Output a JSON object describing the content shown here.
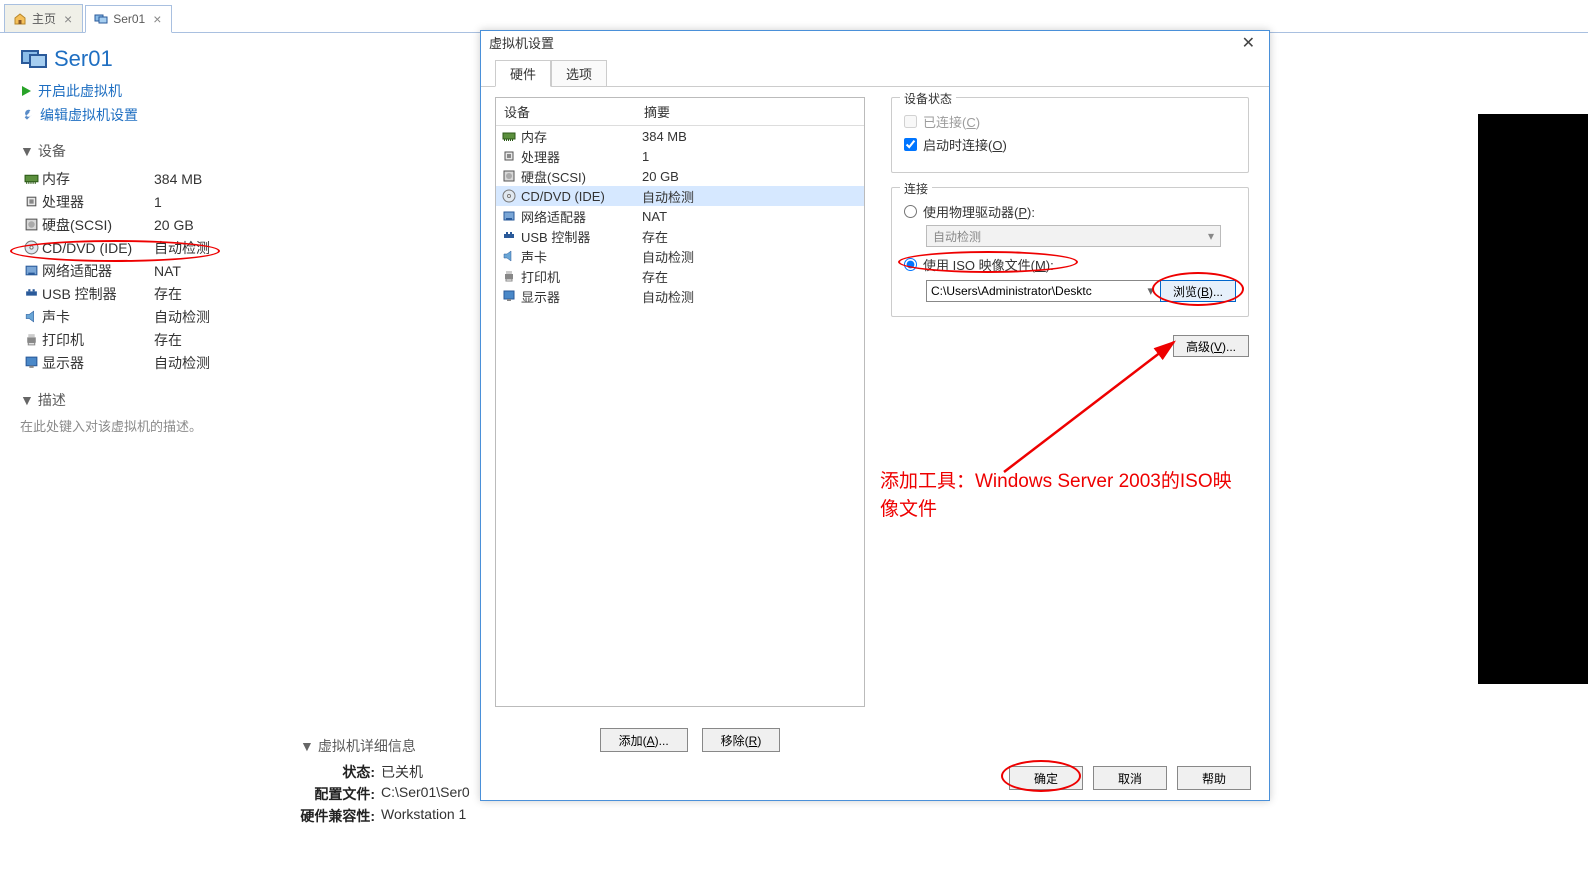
{
  "tabs": {
    "home": "主页",
    "vm": "Ser01"
  },
  "vm": {
    "title": "Ser01",
    "actions": {
      "power_on": "开启此虚拟机",
      "edit_settings": "编辑虚拟机设置"
    }
  },
  "sections": {
    "devices": "设备",
    "description": "描述",
    "details": "虚拟机详细信息"
  },
  "devices": [
    {
      "name": "内存",
      "value": "384 MB",
      "icon": "memory"
    },
    {
      "name": "处理器",
      "value": "1",
      "icon": "cpu"
    },
    {
      "name": "硬盘(SCSI)",
      "value": "20 GB",
      "icon": "disk"
    },
    {
      "name": "CD/DVD (IDE)",
      "value": "自动检测",
      "icon": "cd"
    },
    {
      "name": "网络适配器",
      "value": "NAT",
      "icon": "nic"
    },
    {
      "name": "USB 控制器",
      "value": "存在",
      "icon": "usb"
    },
    {
      "name": "声卡",
      "value": "自动检测",
      "icon": "sound"
    },
    {
      "name": "打印机",
      "value": "存在",
      "icon": "printer"
    },
    {
      "name": "显示器",
      "value": "自动检测",
      "icon": "display"
    }
  ],
  "desc_placeholder": "在此处键入对该虚拟机的描述。",
  "details": {
    "state_label": "状态:",
    "state_value": "已关机",
    "config_label": "配置文件:",
    "config_value": "C:\\Ser01\\Ser0",
    "compat_label": "硬件兼容性:",
    "compat_value": "Workstation 1"
  },
  "dialog": {
    "title": "虚拟机设置",
    "tabs": {
      "hardware": "硬件",
      "options": "选项"
    },
    "columns": {
      "device": "设备",
      "summary": "摘要"
    },
    "hw": [
      {
        "name": "内存",
        "value": "384 MB",
        "icon": "memory"
      },
      {
        "name": "处理器",
        "value": "1",
        "icon": "cpu"
      },
      {
        "name": "硬盘(SCSI)",
        "value": "20 GB",
        "icon": "disk"
      },
      {
        "name": "CD/DVD (IDE)",
        "value": "自动检测",
        "icon": "cd",
        "selected": true
      },
      {
        "name": "网络适配器",
        "value": "NAT",
        "icon": "nic"
      },
      {
        "name": "USB 控制器",
        "value": "存在",
        "icon": "usb"
      },
      {
        "name": "声卡",
        "value": "自动检测",
        "icon": "sound"
      },
      {
        "name": "打印机",
        "value": "存在",
        "icon": "printer"
      },
      {
        "name": "显示器",
        "value": "自动检测",
        "icon": "display"
      }
    ],
    "state": {
      "legend": "设备状态",
      "connected": "已连接(C)",
      "connect_on_start": "启动时连接(O)"
    },
    "conn": {
      "legend": "连接",
      "use_physical": "使用物理驱动器(P):",
      "auto_detect": "自动检测",
      "use_iso": "使用 ISO 映像文件(M):",
      "iso_path": "C:\\Users\\Administrator\\Desktc",
      "browse": "浏览(B)..."
    },
    "advanced": "高级(V)...",
    "add": "添加(A)...",
    "remove": "移除(R)",
    "ok": "确定",
    "cancel": "取消",
    "help": "帮助"
  },
  "annotation": "添加工具：Windows Server 2003的ISO映像文件"
}
